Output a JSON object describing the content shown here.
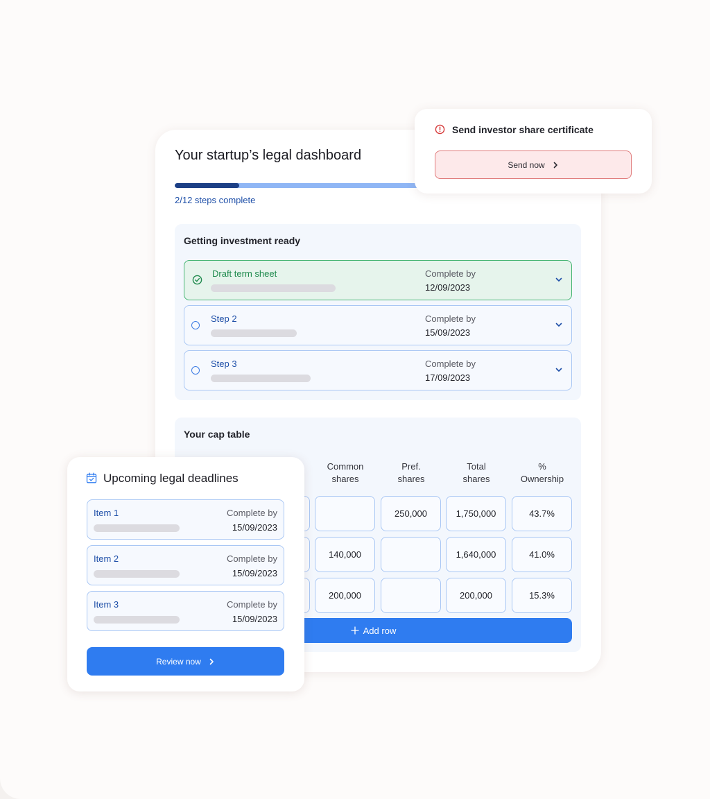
{
  "dashboard": {
    "title": "Your startup’s legal dashboard",
    "progress": {
      "completed": 2,
      "total": 12,
      "text": "2/12 steps complete"
    },
    "investment_section": {
      "title": "Getting investment ready",
      "steps": [
        {
          "name": "Draft term sheet",
          "complete_label": "Complete by",
          "date": "12/09/2023",
          "status": "done"
        },
        {
          "name": "Step 2",
          "complete_label": "Complete by",
          "date": "15/09/2023",
          "status": "pending"
        },
        {
          "name": "Step 3",
          "complete_label": "Complete by",
          "date": "17/09/2023",
          "status": "pending"
        }
      ]
    },
    "cap_table": {
      "title": "Your cap table",
      "columns": [
        "Common shares",
        "Pref. shares",
        "Total shares",
        "% Ownership"
      ],
      "rows": [
        [
          "",
          "250,000",
          "1,750,000",
          "43.7%"
        ],
        [
          "140,000",
          "",
          "1,640,000",
          "41.0%"
        ],
        [
          "200,000",
          "",
          "200,000",
          "15.3%"
        ]
      ],
      "add_row_label": "Add row"
    }
  },
  "certificate_card": {
    "title": "Send investor share certificate",
    "button_label": "Send now"
  },
  "deadlines_card": {
    "title": "Upcoming legal deadlines",
    "items": [
      {
        "name": "Item 1",
        "complete_label": "Complete by",
        "date": "15/09/2023"
      },
      {
        "name": "Item 2",
        "complete_label": "Complete by",
        "date": "15/09/2023"
      },
      {
        "name": "Item 3",
        "complete_label": "Complete by",
        "date": "15/09/2023"
      }
    ],
    "button_label": "Review now"
  },
  "colors": {
    "accent_blue": "#2f7cf0",
    "progress_dark": "#1c3f85",
    "success_green": "#1f8a4d",
    "warning_red": "#d63b3b"
  }
}
